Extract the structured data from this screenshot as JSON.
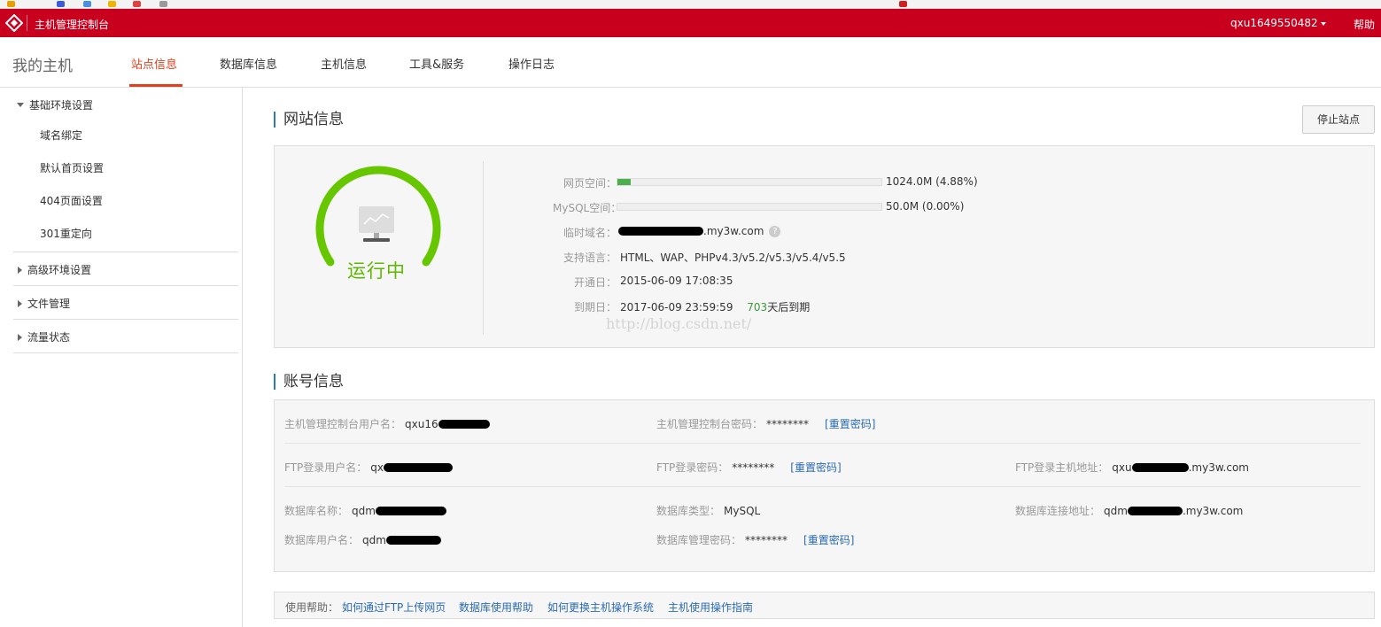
{
  "colors": {
    "brand_red": "#c8001e",
    "accent": "#e0401e",
    "link": "#2a6bb3",
    "running": "#5fb800",
    "progress": "#4cae4c"
  },
  "topbar": {
    "title": "主机管理控制台",
    "username": "qxu1649550482",
    "help": "帮助"
  },
  "nav": {
    "host_title": "我的主机",
    "tabs": [
      {
        "label": "站点信息",
        "active": true
      },
      {
        "label": "数据库信息"
      },
      {
        "label": "主机信息"
      },
      {
        "label": "工具&服务"
      },
      {
        "label": "操作日志"
      }
    ]
  },
  "sidebar": {
    "groups": [
      {
        "label": "基础环境设置",
        "expanded": true,
        "items": [
          "域名绑定",
          "默认首页设置",
          "404页面设置",
          "301重定向"
        ]
      },
      {
        "label": "高级环境设置",
        "expanded": false
      },
      {
        "label": "文件管理",
        "expanded": false
      },
      {
        "label": "流量状态",
        "expanded": false
      }
    ]
  },
  "site": {
    "title": "网站信息",
    "stop_button": "停止站点",
    "status": "运行中",
    "web_space": {
      "label": "网页空间：",
      "value": "1024.0M (4.88%)",
      "percent": 4.88
    },
    "mysql_space": {
      "label": "MySQL空间：",
      "value": "50.0M (0.00%)",
      "percent": 0.0
    },
    "temp_domain": {
      "label": "临时域名：",
      "suffix": ".my3w.com",
      "help_icon": "?"
    },
    "languages": {
      "label": "支持语言：",
      "value": "HTML、WAP、PHPv4.3/v5.2/v5.3/v5.4/v5.5"
    },
    "open_date": {
      "label": "开通日：",
      "value": "2015-06-09 17:08:35"
    },
    "expire_date": {
      "label": "到期日：",
      "value": "2017-06-09 23:59:59",
      "days": "703",
      "days_suffix": "天后到期"
    },
    "watermark": "http://blog.csdn.net/"
  },
  "account": {
    "title": "账号信息",
    "console_user": {
      "label": "主机管理控制台用户名：",
      "value": "qxu16"
    },
    "console_pwd": {
      "label": "主机管理控制台密码：",
      "value": "********",
      "link": "[重置密码]"
    },
    "ftp_user": {
      "label": "FTP登录用户名：",
      "value": "qx"
    },
    "ftp_pwd": {
      "label": "FTP登录密码：",
      "value": "********",
      "link": "[重置密码]"
    },
    "ftp_host": {
      "label": "FTP登录主机地址：",
      "value_prefix": "qxu",
      "value_suffix": ".my3w.com"
    },
    "db_name": {
      "label": "数据库名称：",
      "value": "qdm"
    },
    "db_type": {
      "label": "数据库类型：",
      "value": "MySQL"
    },
    "db_host": {
      "label": "数据库连接地址：",
      "value_prefix": "qdm",
      "value_suffix": ".my3w.com"
    },
    "db_user": {
      "label": "数据库用户名：",
      "value": "qdm"
    },
    "db_pwd": {
      "label": "数据库管理密码：",
      "value": "********",
      "link": "[重置密码]"
    }
  },
  "help": {
    "label": "使用帮助：",
    "links": [
      "如何通过FTP上传网页",
      "数据库使用帮助",
      "如何更换主机操作系统",
      "主机使用操作指南"
    ]
  }
}
